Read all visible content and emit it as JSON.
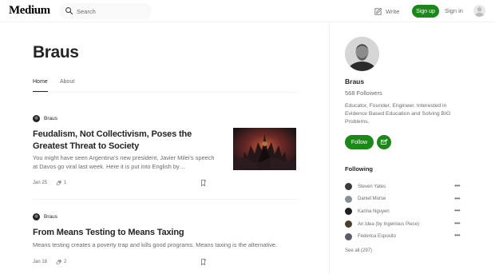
{
  "header": {
    "logo": "Medium",
    "search_placeholder": "Search",
    "write_label": "Write",
    "signup_label": "Sign up",
    "signin_label": "Sign in"
  },
  "main": {
    "title": "Braus",
    "tabs": [
      {
        "label": "Home",
        "active": true
      },
      {
        "label": "About",
        "active": false
      }
    ],
    "articles": [
      {
        "author": "Braus",
        "title": "Feudalism, Not Collectivism, Poses the Greatest Threat to Society",
        "subtitle": "You might have seen Argentina’s new president, Javier Milei’s speech at Davos go viral last week. Here it is put into English by…",
        "date": "Jan 25",
        "claps": "1",
        "has_image": true
      },
      {
        "author": "Braus",
        "title": "From Means Testing to Means Taxing",
        "subtitle": "Means testing creates a poverty trap and kills good programs. Means taxing is the alternative.",
        "date": "Jan 18",
        "claps": "2",
        "has_image": false
      }
    ]
  },
  "sidebar": {
    "name": "Braus",
    "followers": "568 Followers",
    "bio": "Educator, Founder, Engineer. Interested in Evidence Based Education and Solving BIG Problems.",
    "follow_label": "Follow",
    "following_heading": "Following",
    "following": [
      {
        "name": "Steven Yates",
        "color": "#3a3a3a"
      },
      {
        "name": "Daniel Morse",
        "color": "#8a8f96"
      },
      {
        "name": "Karina Nguyen",
        "color": "#1f1f1f"
      },
      {
        "name": "An Idea (by Ingenious Piece)",
        "color": "#4a3f2a"
      },
      {
        "name": "Federica Esposito",
        "color": "#5b5b6b"
      }
    ],
    "see_all": "See all (297)"
  },
  "colors": {
    "brand_green": "#1a8917",
    "text_primary": "#242424",
    "text_secondary": "#6b6b6b"
  }
}
